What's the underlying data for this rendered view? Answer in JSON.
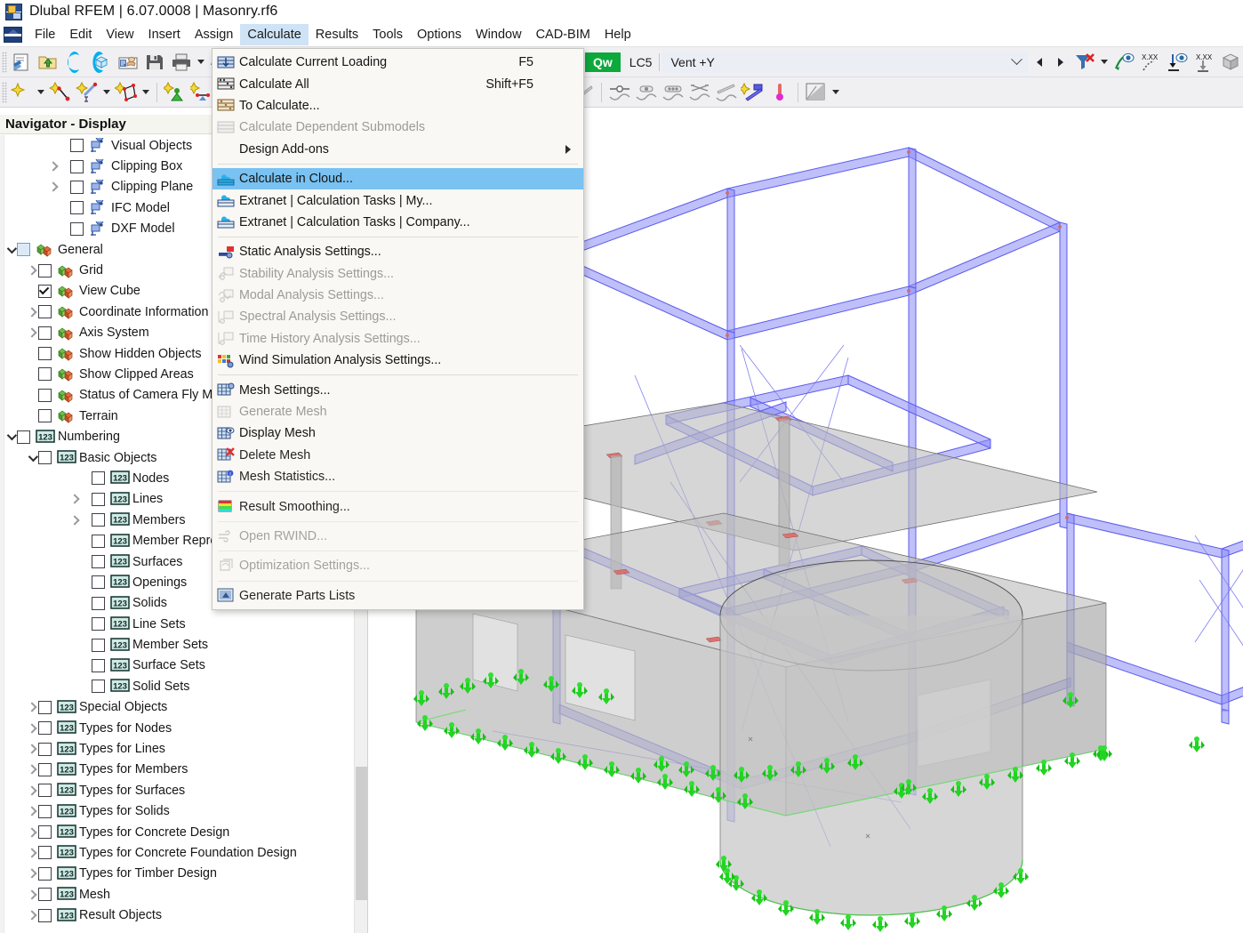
{
  "window": {
    "title": "Dlubal RFEM | 6.07.0008 | Masonry.rf6",
    "app_icon": "rfem-app-icon"
  },
  "menubar": {
    "logo_icon": "dlubal-logo-icon",
    "items": [
      {
        "label": "File",
        "active": false
      },
      {
        "label": "Edit",
        "active": false
      },
      {
        "label": "View",
        "active": false
      },
      {
        "label": "Insert",
        "active": false
      },
      {
        "label": "Assign",
        "active": false
      },
      {
        "label": "Calculate",
        "active": true
      },
      {
        "label": "Results",
        "active": false
      },
      {
        "label": "Tools",
        "active": false
      },
      {
        "label": "Options",
        "active": false
      },
      {
        "label": "Window",
        "active": false
      },
      {
        "label": "CAD-BIM",
        "active": false
      },
      {
        "label": "Help",
        "active": false
      }
    ]
  },
  "calculate_menu": {
    "items": [
      {
        "label": "Calculate Current Loading",
        "shortcut": "F5",
        "icon": "calculate-current-loading-icon",
        "state": "normal",
        "submenu": false
      },
      {
        "label": "Calculate All",
        "shortcut": "Shift+F5",
        "icon": "calculate-all-icon",
        "state": "normal",
        "submenu": false
      },
      {
        "label": "To Calculate...",
        "shortcut": "",
        "icon": "to-calculate-icon",
        "state": "normal",
        "submenu": false
      },
      {
        "label": "Calculate Dependent Submodels",
        "shortcut": "",
        "icon": "calculate-dependent-submodels-icon",
        "state": "disabled",
        "submenu": false
      },
      {
        "label": "Design Add-ons",
        "shortcut": "",
        "icon": "",
        "state": "normal",
        "submenu": true
      },
      {
        "separator": true
      },
      {
        "label": "Calculate in Cloud...",
        "shortcut": "",
        "icon": "cloud-calculate-icon",
        "state": "selected",
        "submenu": false
      },
      {
        "label": "Extranet | Calculation Tasks | My...",
        "shortcut": "",
        "icon": "extranet-my-icon",
        "state": "normal",
        "submenu": false
      },
      {
        "label": "Extranet | Calculation Tasks | Company...",
        "shortcut": "",
        "icon": "extranet-company-icon",
        "state": "normal",
        "submenu": false
      },
      {
        "separator": true
      },
      {
        "label": "Static Analysis Settings...",
        "shortcut": "",
        "icon": "static-analysis-icon",
        "state": "normal",
        "submenu": false
      },
      {
        "label": "Stability Analysis Settings...",
        "shortcut": "",
        "icon": "stability-analysis-icon",
        "state": "disabled",
        "submenu": false
      },
      {
        "label": "Modal Analysis Settings...",
        "shortcut": "",
        "icon": "modal-analysis-icon",
        "state": "disabled",
        "submenu": false
      },
      {
        "label": "Spectral Analysis Settings...",
        "shortcut": "",
        "icon": "spectral-analysis-icon",
        "state": "disabled",
        "submenu": false
      },
      {
        "label": "Time History Analysis Settings...",
        "shortcut": "",
        "icon": "time-history-analysis-icon",
        "state": "disabled",
        "submenu": false
      },
      {
        "label": "Wind Simulation Analysis Settings...",
        "shortcut": "",
        "icon": "wind-simulation-icon",
        "state": "normal",
        "submenu": false
      },
      {
        "separator": true
      },
      {
        "label": "Mesh Settings...",
        "shortcut": "",
        "icon": "mesh-settings-icon",
        "state": "normal",
        "submenu": false
      },
      {
        "label": "Generate Mesh",
        "shortcut": "",
        "icon": "generate-mesh-icon",
        "state": "disabled",
        "submenu": false
      },
      {
        "label": "Display Mesh",
        "shortcut": "",
        "icon": "display-mesh-icon",
        "state": "normal",
        "submenu": false
      },
      {
        "label": "Delete Mesh",
        "shortcut": "",
        "icon": "delete-mesh-icon",
        "state": "normal",
        "submenu": false
      },
      {
        "label": "Mesh Statistics...",
        "shortcut": "",
        "icon": "mesh-statistics-icon",
        "state": "normal",
        "submenu": false
      },
      {
        "separator": true
      },
      {
        "label": "Result Smoothing...",
        "shortcut": "",
        "icon": "result-smoothing-icon",
        "state": "normal",
        "submenu": false
      },
      {
        "separator": true
      },
      {
        "label": "Open RWIND...",
        "shortcut": "",
        "icon": "open-rwind-icon",
        "state": "disabled",
        "submenu": false
      },
      {
        "separator": true
      },
      {
        "label": "Optimization Settings...",
        "shortcut": "",
        "icon": "optimization-settings-icon",
        "state": "disabled",
        "submenu": false
      },
      {
        "separator": true
      },
      {
        "label": "Generate Parts Lists",
        "shortcut": "",
        "icon": "generate-parts-lists-icon",
        "state": "normal",
        "submenu": false
      }
    ]
  },
  "toolbar_row1": {
    "buttons": [
      {
        "icon": "new-model-icon"
      },
      {
        "icon": "open-folder-icon"
      },
      {
        "icon": "dlubal-center-icon"
      },
      {
        "icon": "model-cube-icon"
      },
      {
        "icon": "project-manager-icon"
      },
      {
        "icon": "save-icon"
      },
      {
        "icon": "print-icon"
      },
      {
        "icon": "print-preview-icon"
      },
      {
        "icon": "undo-icon"
      },
      {
        "icon": "redo-icon"
      },
      {
        "icon": "cut-icon"
      },
      {
        "icon": "copy-icon"
      },
      {
        "icon": "paste-icon"
      },
      {
        "icon": "select-polygon-icon"
      },
      {
        "icon": "special-selection-icon"
      },
      {
        "icon": "import-above-icon"
      },
      {
        "icon": "import-below-icon"
      }
    ]
  },
  "load_case_bar": {
    "swatch_1": "#e2f0fb",
    "swatch_2": "#d9edfa",
    "qw_badge": "Qw",
    "qw_color": "#0ca93c",
    "load_case_id": "LC5",
    "load_case_name": "Vent +Y"
  },
  "toolbar_row2": {
    "buttons": [
      {
        "icon": "new-node-icon"
      },
      {
        "icon": "new-line-icon"
      },
      {
        "icon": "new-member-icon"
      },
      {
        "icon": "new-surface-icon"
      },
      {
        "icon": "new-solid-icon"
      },
      {
        "icon": "new-nodal-support-icon"
      },
      {
        "icon": "new-line-support-icon"
      },
      {
        "icon": "new-member-support-icon"
      },
      {
        "icon": "new-surface-support-icon"
      },
      {
        "icon": "new-hinge-icon"
      },
      {
        "icon": "new-load-icon"
      },
      {
        "icon": "filter-results-icon"
      },
      {
        "icon": "result-diagram-icon"
      },
      {
        "icon": "result-section-icon"
      },
      {
        "icon": "animation-icon"
      },
      {
        "icon": "deformation-icon"
      },
      {
        "icon": "surface-results-icon"
      },
      {
        "icon": "solid-results-icon"
      },
      {
        "icon": "viewpoint-icon"
      },
      {
        "icon": "member-result-icon"
      },
      {
        "icon": "line-release-icon"
      },
      {
        "icon": "member-release-icon"
      },
      {
        "icon": "member-eccentricity-icon"
      },
      {
        "icon": "member-nonlinearity-icon"
      },
      {
        "icon": "member-division-icon"
      },
      {
        "icon": "new-result-beam-icon"
      },
      {
        "icon": "thermometer-icon"
      },
      {
        "icon": "render-mode-icon"
      }
    ]
  },
  "navigator": {
    "title": "Navigator - Display",
    "items": [
      {
        "label": "Visual Objects",
        "indent": 2,
        "twisty": "none",
        "check": "empty",
        "icon": "display-pin-icon"
      },
      {
        "label": "Clipping Box",
        "indent": 2,
        "twisty": "right",
        "check": "empty",
        "icon": "display-pin-icon"
      },
      {
        "label": "Clipping Plane",
        "indent": 2,
        "twisty": "right",
        "check": "empty",
        "icon": "display-pin-icon"
      },
      {
        "label": "IFC Model",
        "indent": 2,
        "twisty": "none",
        "check": "empty",
        "icon": "display-pin-icon"
      },
      {
        "label": "DXF Model",
        "indent": 2,
        "twisty": "none",
        "check": "empty",
        "icon": "display-pin-icon"
      },
      {
        "label": "General",
        "indent": 0,
        "twisty": "down",
        "check": "partial",
        "icon": "cubes-icon"
      },
      {
        "label": "Grid",
        "indent": 1,
        "twisty": "right",
        "check": "empty",
        "icon": "cubes-icon"
      },
      {
        "label": "View Cube",
        "indent": 1,
        "twisty": "none",
        "check": "checked",
        "icon": "cubes-icon"
      },
      {
        "label": "Coordinate Information",
        "indent": 1,
        "twisty": "right",
        "check": "empty",
        "icon": "cubes-icon"
      },
      {
        "label": "Axis System",
        "indent": 1,
        "twisty": "right",
        "check": "empty",
        "icon": "cubes-icon"
      },
      {
        "label": "Show Hidden Objects",
        "indent": 1,
        "twisty": "none",
        "check": "empty",
        "icon": "cubes-icon"
      },
      {
        "label": "Show Clipped Areas",
        "indent": 1,
        "twisty": "none",
        "check": "empty",
        "icon": "cubes-icon"
      },
      {
        "label": "Status of Camera Fly Mode",
        "indent": 1,
        "twisty": "none",
        "check": "empty",
        "icon": "cubes-icon"
      },
      {
        "label": "Terrain",
        "indent": 1,
        "twisty": "none",
        "check": "empty",
        "icon": "cubes-icon"
      },
      {
        "label": "Numbering",
        "indent": 0,
        "twisty": "down",
        "check": "empty",
        "icon": "numbering-icon"
      },
      {
        "label": "Basic Objects",
        "indent": 1,
        "twisty": "down",
        "check": "empty",
        "icon": "numbering-icon"
      },
      {
        "label": "Nodes",
        "indent": 3,
        "twisty": "none",
        "check": "empty",
        "icon": "numbering-icon"
      },
      {
        "label": "Lines",
        "indent": 3,
        "twisty": "right",
        "check": "empty",
        "icon": "numbering-icon"
      },
      {
        "label": "Members",
        "indent": 3,
        "twisty": "right",
        "check": "empty",
        "icon": "numbering-icon"
      },
      {
        "label": "Member Representatives",
        "indent": 3,
        "twisty": "none",
        "check": "empty",
        "icon": "numbering-icon"
      },
      {
        "label": "Surfaces",
        "indent": 3,
        "twisty": "none",
        "check": "empty",
        "icon": "numbering-icon"
      },
      {
        "label": "Openings",
        "indent": 3,
        "twisty": "none",
        "check": "empty",
        "icon": "numbering-icon"
      },
      {
        "label": "Solids",
        "indent": 3,
        "twisty": "none",
        "check": "empty",
        "icon": "numbering-icon"
      },
      {
        "label": "Line Sets",
        "indent": 3,
        "twisty": "none",
        "check": "empty",
        "icon": "numbering-icon"
      },
      {
        "label": "Member Sets",
        "indent": 3,
        "twisty": "none",
        "check": "empty",
        "icon": "numbering-icon"
      },
      {
        "label": "Surface Sets",
        "indent": 3,
        "twisty": "none",
        "check": "empty",
        "icon": "numbering-icon"
      },
      {
        "label": "Solid Sets",
        "indent": 3,
        "twisty": "none",
        "check": "empty",
        "icon": "numbering-icon"
      },
      {
        "label": "Special Objects",
        "indent": 1,
        "twisty": "right",
        "check": "empty",
        "icon": "numbering-icon"
      },
      {
        "label": "Types for Nodes",
        "indent": 1,
        "twisty": "right",
        "check": "empty",
        "icon": "numbering-icon"
      },
      {
        "label": "Types for Lines",
        "indent": 1,
        "twisty": "right",
        "check": "empty",
        "icon": "numbering-icon"
      },
      {
        "label": "Types for Members",
        "indent": 1,
        "twisty": "right",
        "check": "empty",
        "icon": "numbering-icon"
      },
      {
        "label": "Types for Surfaces",
        "indent": 1,
        "twisty": "right",
        "check": "empty",
        "icon": "numbering-icon"
      },
      {
        "label": "Types for Solids",
        "indent": 1,
        "twisty": "right",
        "check": "empty",
        "icon": "numbering-icon"
      },
      {
        "label": "Types for Concrete Design",
        "indent": 1,
        "twisty": "right",
        "check": "empty",
        "icon": "numbering-icon"
      },
      {
        "label": "Types for Concrete Foundation Design",
        "indent": 1,
        "twisty": "right",
        "check": "empty",
        "icon": "numbering-icon"
      },
      {
        "label": "Types for Timber Design",
        "indent": 1,
        "twisty": "right",
        "check": "empty",
        "icon": "numbering-icon"
      },
      {
        "label": "Mesh",
        "indent": 1,
        "twisty": "right",
        "check": "empty",
        "icon": "numbering-icon"
      },
      {
        "label": "Result Objects",
        "indent": 1,
        "twisty": "right",
        "check": "empty",
        "icon": "numbering-icon"
      }
    ]
  },
  "viewport": {
    "model_name": "Masonry structural model",
    "colors": {
      "member_blue": "#6b6bf0",
      "surface_gray": "#b8b8b8",
      "support_green": "#1fd41f",
      "node_red": "#d06a6a",
      "background": "#ffffff"
    }
  }
}
